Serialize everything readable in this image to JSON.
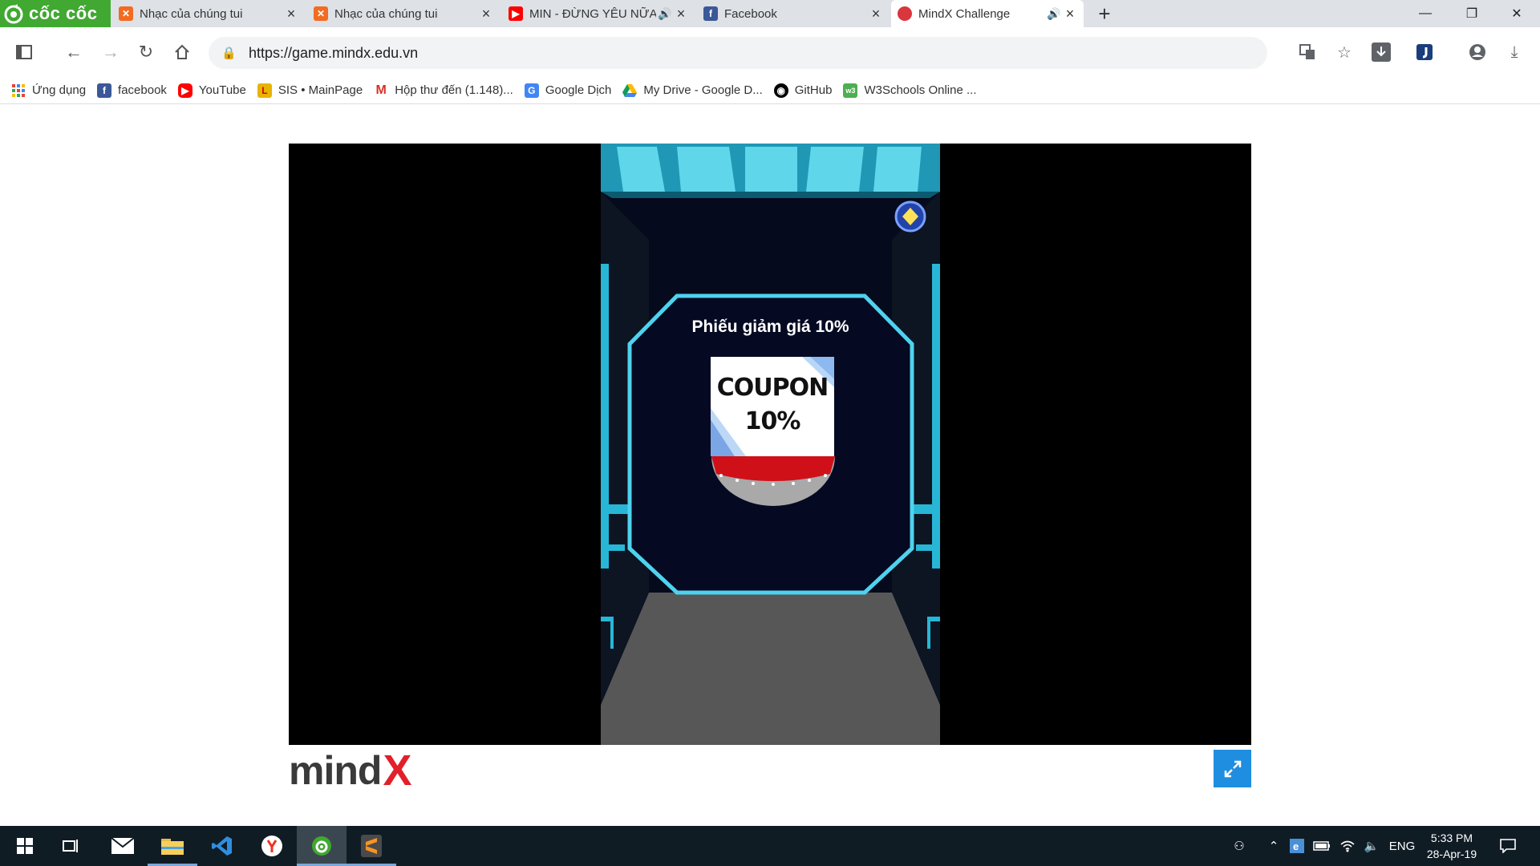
{
  "browser": {
    "brand": "cốc cốc",
    "tabs": [
      {
        "title": "Nhạc của chúng tui",
        "icon": "xampp-icon",
        "audio": false,
        "active": false
      },
      {
        "title": "Nhạc của chúng tui",
        "icon": "xampp-icon",
        "audio": false,
        "active": false
      },
      {
        "title": "MIN - ĐỪNG YÊU NỮA",
        "icon": "youtube-icon",
        "audio": true,
        "active": false
      },
      {
        "title": "Facebook",
        "icon": "facebook-icon",
        "audio": false,
        "active": false
      },
      {
        "title": "MindX Challenge",
        "icon": "mindx-icon",
        "audio": true,
        "active": true
      }
    ],
    "new_tab": "+",
    "window_controls": {
      "minimize": "—",
      "restore": "❐",
      "close": "✕"
    },
    "url": "https://game.mindx.edu.vn",
    "bookmarks": [
      {
        "label": "Ứng dụng",
        "icon": "apps-grid-icon",
        "color": "#e94235"
      },
      {
        "label": "facebook",
        "icon": "facebook-icon",
        "color": "#3b5998"
      },
      {
        "label": "YouTube",
        "icon": "youtube-icon",
        "color": "#ff0000"
      },
      {
        "label": "SIS • MainPage",
        "icon": "sis-icon",
        "color": "#e8b400"
      },
      {
        "label": "Hộp thư đến (1.148)...",
        "icon": "gmail-icon",
        "color": "#d93025"
      },
      {
        "label": "Google Dịch",
        "icon": "google-translate-icon",
        "color": "#4285f4"
      },
      {
        "label": "My Drive - Google D...",
        "icon": "google-drive-icon",
        "color": "#0f9d58"
      },
      {
        "label": "GitHub",
        "icon": "github-icon",
        "color": "#000000"
      },
      {
        "label": "W3Schools Online ...",
        "icon": "w3schools-icon",
        "color": "#4caf50"
      }
    ]
  },
  "game": {
    "popup_title": "Phiếu giảm giá 10%",
    "coupon_line1": "COUPON",
    "coupon_line2": "10%"
  },
  "footer": {
    "logo_text": "mind",
    "logo_x": "X"
  },
  "taskbar": {
    "language": "ENG",
    "time": "5:33 PM",
    "date": "28-Apr-19"
  }
}
